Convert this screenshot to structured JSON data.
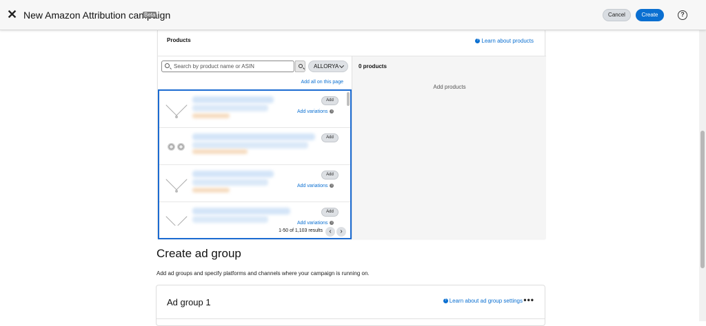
{
  "header": {
    "title": "New Amazon Attribution campaign",
    "badge": "Beta",
    "cancel_label": "Cancel",
    "create_label": "Create",
    "help_icon": "?"
  },
  "products": {
    "title": "Products",
    "learn_link": "Learn about products",
    "search": {
      "placeholder": "Search by product name or ASIN"
    },
    "brand_filter": "ALLORYA",
    "add_all": "Add all on this page",
    "items": [
      {
        "type": "necklace",
        "add_label": "Add",
        "variations_label": "Add variations"
      },
      {
        "type": "earrings",
        "add_label": "Add",
        "variations_label": ""
      },
      {
        "type": "necklace",
        "add_label": "Add",
        "variations_label": "Add variations"
      },
      {
        "type": "necklace",
        "add_label": "Add",
        "variations_label": "Add variations"
      }
    ],
    "results_text": "1-50 of 1,103 results",
    "selected_title": "0 products",
    "selected_empty": "Add products"
  },
  "ad_group_section": {
    "title": "Create ad group",
    "description": "Add ad groups and specify platforms and channels where your campaign is running on.",
    "card_title": "Ad group 1",
    "learn_link": "Learn about ad group settings",
    "more_icon": "•••"
  },
  "colors": {
    "accent": "#0a6fd1",
    "selection_border": "#1a6ad1"
  }
}
